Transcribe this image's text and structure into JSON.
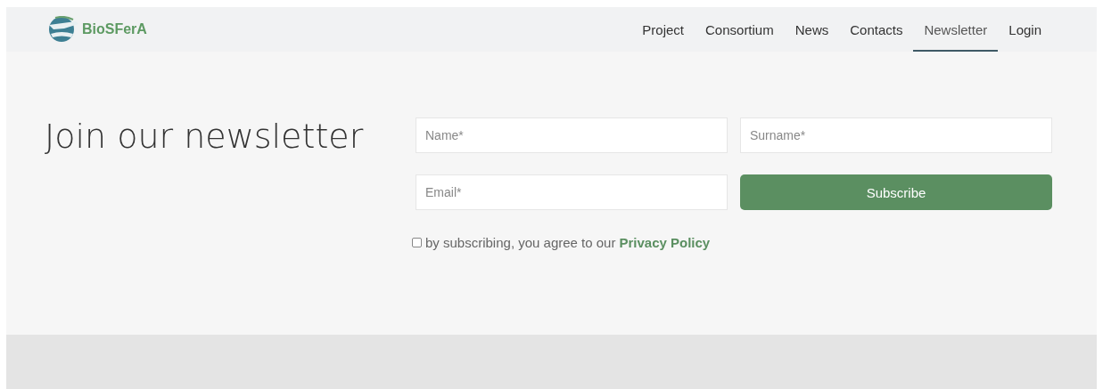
{
  "header": {
    "logo": {
      "name": "BioSFerA"
    },
    "nav": [
      {
        "label": "Project",
        "selected": false
      },
      {
        "label": "Consortium",
        "selected": false
      },
      {
        "label": "News",
        "selected": false
      },
      {
        "label": "Contacts",
        "selected": false
      },
      {
        "label": "Newsletter",
        "selected": true
      },
      {
        "label": "Login",
        "selected": false
      }
    ]
  },
  "newsletter": {
    "title": "Join our newsletter",
    "fields": [
      {
        "placeholder": "Name*"
      },
      {
        "placeholder": "Surname*"
      },
      {
        "placeholder": "Email*"
      }
    ],
    "button": "Subscribe",
    "consent": {
      "checked": false,
      "text": "by subscribing, you agree to our",
      "link": "Privacy Policy"
    }
  }
}
